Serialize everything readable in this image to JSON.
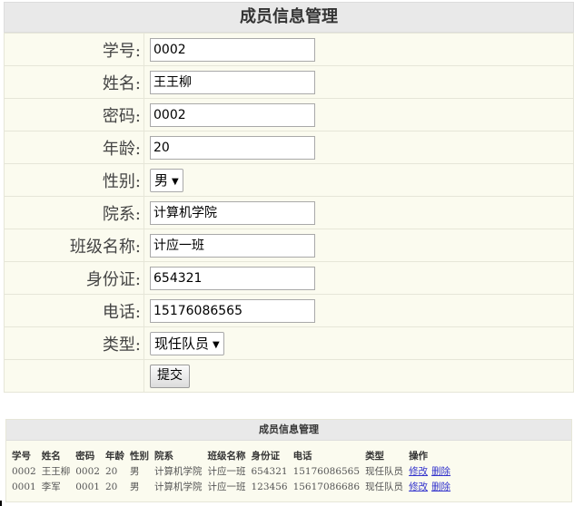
{
  "form": {
    "title": "成员信息管理",
    "fields": {
      "student_id": {
        "label": "学号:",
        "value": "0002"
      },
      "name": {
        "label": "姓名:",
        "value": "王王柳"
      },
      "password": {
        "label": "密码:",
        "value": "0002"
      },
      "age": {
        "label": "年龄:",
        "value": "20"
      },
      "gender": {
        "label": "性别:",
        "value": "男"
      },
      "department": {
        "label": "院系:",
        "value": "计算机学院"
      },
      "class_name": {
        "label": "班级名称:",
        "value": "计应一班"
      },
      "id_card": {
        "label": "身份证:",
        "value": "654321"
      },
      "phone": {
        "label": "电话:",
        "value": "15176086565"
      },
      "type": {
        "label": "类型:",
        "value": "现任队员"
      }
    },
    "submit_label": "提交"
  },
  "list": {
    "title": "成员信息管理",
    "columns": [
      "学号",
      "姓名",
      "密码",
      "年龄",
      "性别",
      "院系",
      "班级名称",
      "身份证",
      "电话",
      "类型",
      "操作"
    ],
    "rows": [
      {
        "student_id": "0002",
        "name": "王王柳",
        "password": "0002",
        "age": "20",
        "gender": "男",
        "department": "计算机学院",
        "class_name": "计应一班",
        "id_card": "654321",
        "phone": "15176086565",
        "type": "现任队员",
        "edit": "修改",
        "delete": "删除"
      },
      {
        "student_id": "0001",
        "name": "李军",
        "password": "0001",
        "age": "20",
        "gender": "男",
        "department": "计算机学院",
        "class_name": "计应一班",
        "id_card": "123456",
        "phone": "15617086686",
        "type": "现任队员",
        "edit": "修改",
        "delete": "删除"
      }
    ]
  }
}
